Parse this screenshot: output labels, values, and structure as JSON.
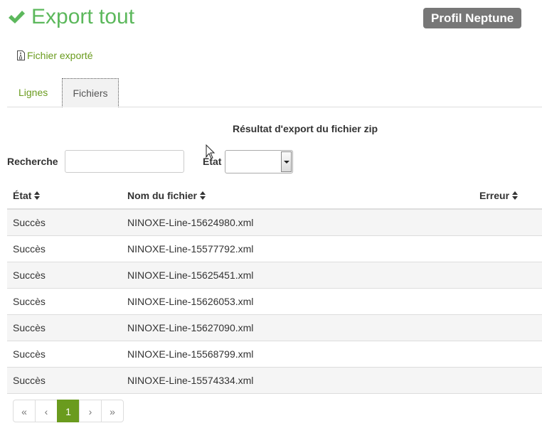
{
  "header": {
    "title": "Export tout",
    "profile": "Profil Neptune"
  },
  "file_link": {
    "label": "Fichier exporté"
  },
  "tabs": [
    {
      "label": "Lignes",
      "active": false
    },
    {
      "label": "Fichiers",
      "active": true
    }
  ],
  "result_title": "Résultat d'export du fichier zip",
  "filters": {
    "search_label": "Recherche",
    "search_value": "",
    "state_label": "État",
    "state_value": ""
  },
  "table": {
    "columns": [
      "État",
      "Nom du fichier",
      "Erreur"
    ],
    "rows": [
      {
        "state": "Succès",
        "file": "NINOXE-Line-15624980.xml",
        "error": ""
      },
      {
        "state": "Succès",
        "file": "NINOXE-Line-15577792.xml",
        "error": ""
      },
      {
        "state": "Succès",
        "file": "NINOXE-Line-15625451.xml",
        "error": ""
      },
      {
        "state": "Succès",
        "file": "NINOXE-Line-15626053.xml",
        "error": ""
      },
      {
        "state": "Succès",
        "file": "NINOXE-Line-15627090.xml",
        "error": ""
      },
      {
        "state": "Succès",
        "file": "NINOXE-Line-15568799.xml",
        "error": ""
      },
      {
        "state": "Succès",
        "file": "NINOXE-Line-15574334.xml",
        "error": ""
      }
    ]
  },
  "pagination": {
    "first": "«",
    "prev": "‹",
    "current": "1",
    "next": "›",
    "last": "»"
  },
  "colors": {
    "success_green": "#5cb85c",
    "link_green": "#6a9b1e",
    "badge_gray": "#777777"
  },
  "icons": {
    "title": "check-icon",
    "file_link": "file-archive-icon",
    "sort": "sort-icon"
  }
}
